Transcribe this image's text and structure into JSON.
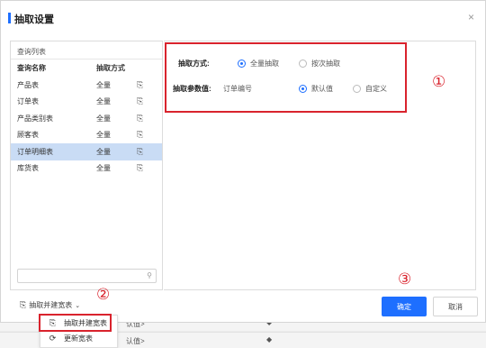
{
  "dialog": {
    "title": "抽取设置",
    "close_symbol": "×"
  },
  "left_panel": {
    "header": "查询列表",
    "columns": [
      "查询名称",
      "抽取方式"
    ],
    "rows": [
      {
        "name": "产品表",
        "mode": "全量",
        "icon": "extract-icon"
      },
      {
        "name": "订单表",
        "mode": "全量",
        "icon": "extract-icon"
      },
      {
        "name": "产品类别表",
        "mode": "全量",
        "icon": "extract-icon"
      },
      {
        "name": "顾客表",
        "mode": "全量",
        "icon": "extract-icon"
      },
      {
        "name": "订单明细表",
        "mode": "全量",
        "icon": "extract-icon",
        "selected": true
      },
      {
        "name": "库货表",
        "mode": "全量",
        "icon": "extract-icon"
      }
    ],
    "search": {
      "value": "",
      "placeholder": ""
    }
  },
  "right_panel": {
    "extract_mode": {
      "label": "抽取方式:",
      "options": [
        "全量抽取",
        "按次抽取"
      ],
      "selected": "全量抽取"
    },
    "extract_param": {
      "label": "抽取参数值:",
      "field": "订单编号",
      "options": [
        "默认值",
        "自定义"
      ],
      "selected": "默认值"
    }
  },
  "footer": {
    "extract_menu_label": "抽取并建宽表",
    "ok_label": "确定",
    "cancel_label": "取消"
  },
  "dropdown": {
    "items": [
      {
        "label": "抽取并建宽表",
        "icon": "extract-icon"
      },
      {
        "label": "更新宽表",
        "icon": "refresh-icon"
      }
    ]
  },
  "background": {
    "rows": [
      "认值>",
      "认值>"
    ]
  },
  "annotations": {
    "one": "①",
    "two": "②",
    "three": "③"
  },
  "colors": {
    "accent": "#1e6fff",
    "annotation": "#d9232d",
    "selected_row": "#c9dcf5"
  }
}
